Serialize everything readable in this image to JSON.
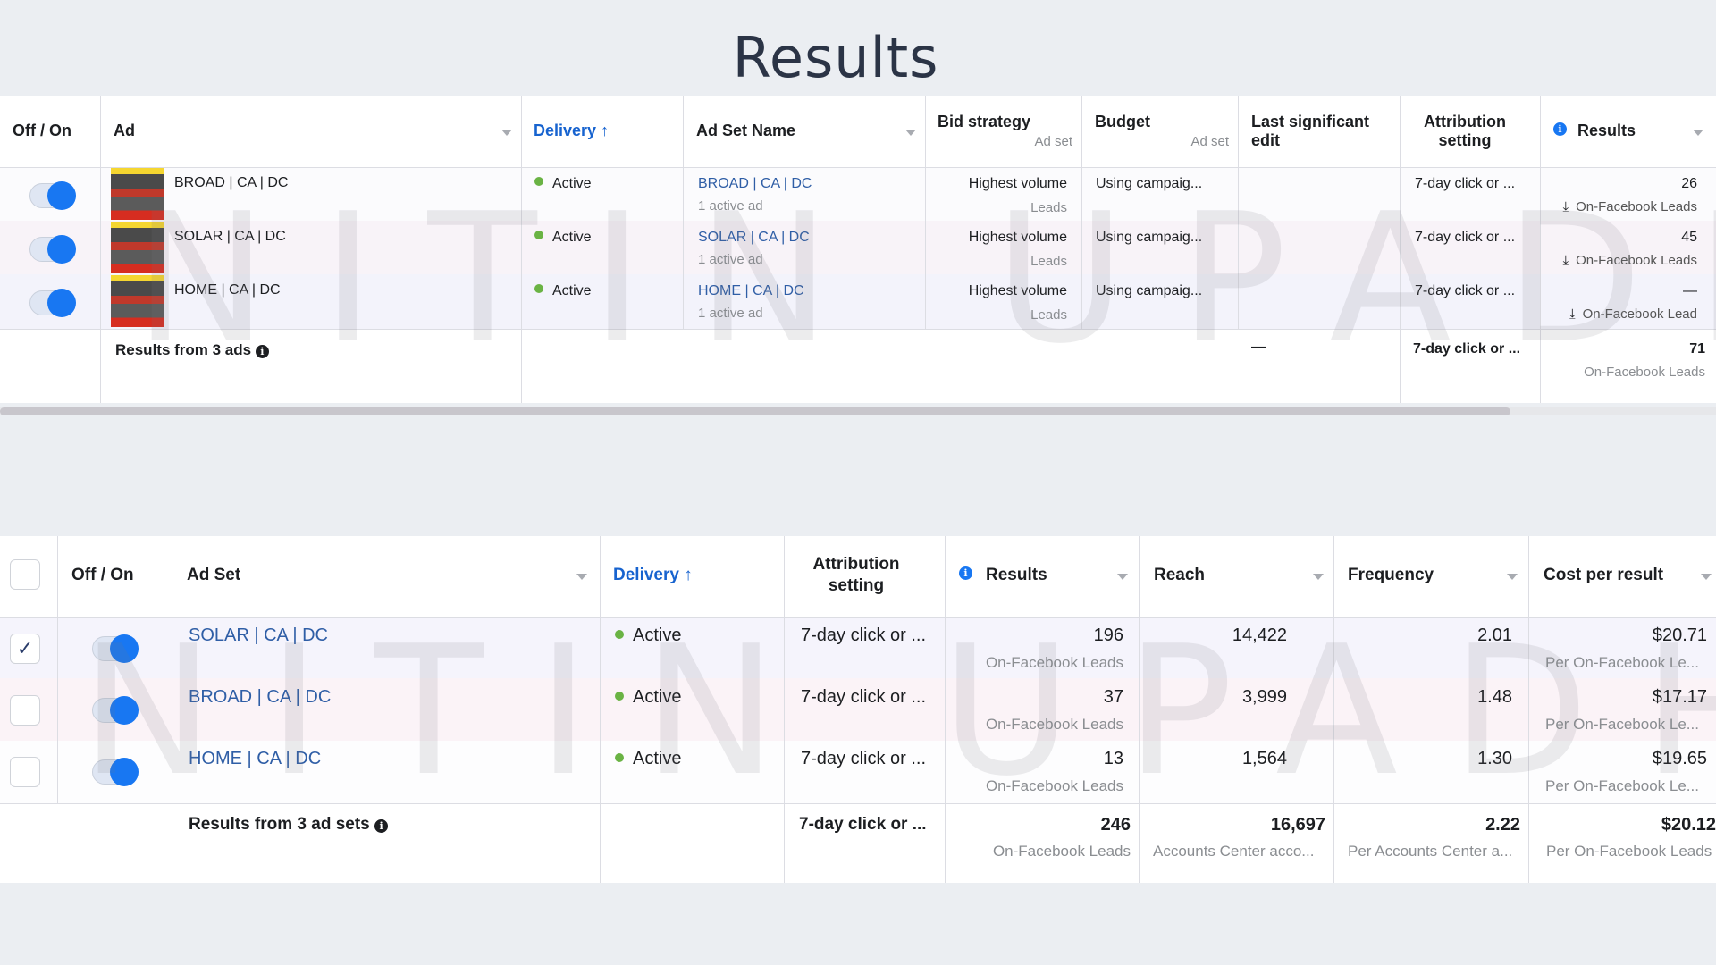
{
  "page": {
    "title": "Results",
    "watermark": "NITIN UPADHYAY"
  },
  "ads_table": {
    "columns": [
      {
        "label": "Off / On"
      },
      {
        "label": "Ad"
      },
      {
        "label": "Delivery",
        "sorted": "ascending",
        "sort_icon": "arrow-up-icon"
      },
      {
        "label": "Ad Set Name"
      },
      {
        "label": "Bid strategy",
        "sublabel": "Ad set"
      },
      {
        "label": "Budget",
        "sublabel": "Ad set"
      },
      {
        "label": "Last significant edit"
      },
      {
        "label": "Attribution setting"
      },
      {
        "label": "Results"
      }
    ],
    "rows": [
      {
        "toggle_on": true,
        "ad": "BROAD | CA | DC",
        "delivery": "Active",
        "ad_set_name": "BROAD | CA | DC",
        "ad_set_sub": "1 active ad",
        "bid_strategy": "Highest volume",
        "bid_sub": "Leads",
        "budget": "Using campaig...",
        "last_edit": "",
        "attribution": "7-day click or ...",
        "results": "26",
        "results_sub": "On-Facebook Leads"
      },
      {
        "toggle_on": true,
        "ad": "SOLAR | CA | DC",
        "delivery": "Active",
        "ad_set_name": "SOLAR | CA | DC",
        "ad_set_sub": "1 active ad",
        "bid_strategy": "Highest volume",
        "bid_sub": "Leads",
        "budget": "Using campaig...",
        "last_edit": "",
        "attribution": "7-day click or ...",
        "results": "45",
        "results_sub": "On-Facebook Leads"
      },
      {
        "toggle_on": true,
        "ad": "HOME | CA | DC",
        "delivery": "Active",
        "ad_set_name": "HOME | CA | DC",
        "ad_set_sub": "1 active ad",
        "bid_strategy": "Highest volume",
        "bid_sub": "Leads",
        "budget": "Using campaig...",
        "last_edit": "",
        "attribution": "7-day click or ...",
        "results": "—",
        "results_sub": "On-Facebook Lead"
      }
    ],
    "summary": {
      "label": "Results from 3 ads",
      "last_edit": "—",
      "attribution": "7-day click or ...",
      "results": "71",
      "results_sub": "On-Facebook Leads"
    }
  },
  "adsets_table": {
    "columns": [
      {
        "label": ""
      },
      {
        "label": "Off / On"
      },
      {
        "label": "Ad Set"
      },
      {
        "label": "Delivery",
        "sorted": "ascending",
        "sort_icon": "arrow-up-icon"
      },
      {
        "label": "Attribution setting"
      },
      {
        "label": "Results"
      },
      {
        "label": "Reach"
      },
      {
        "label": "Frequency"
      },
      {
        "label": "Cost per result"
      }
    ],
    "rows": [
      {
        "selected": true,
        "toggle_on": true,
        "ad_set": "SOLAR | CA | DC",
        "delivery": "Active",
        "attribution": "7-day click or ...",
        "results": "196",
        "results_sub": "On-Facebook Leads",
        "reach": "14,422",
        "frequency": "2.01",
        "cost": "$20.71",
        "cost_sub": "Per On-Facebook Le..."
      },
      {
        "selected": false,
        "toggle_on": true,
        "ad_set": "BROAD | CA | DC",
        "delivery": "Active",
        "attribution": "7-day click or ...",
        "results": "37",
        "results_sub": "On-Facebook Leads",
        "reach": "3,999",
        "frequency": "1.48",
        "cost": "$17.17",
        "cost_sub": "Per On-Facebook Le..."
      },
      {
        "selected": false,
        "toggle_on": true,
        "ad_set": "HOME | CA | DC",
        "delivery": "Active",
        "attribution": "7-day click or ...",
        "results": "13",
        "results_sub": "On-Facebook Leads",
        "reach": "1,564",
        "frequency": "1.30",
        "cost": "$19.65",
        "cost_sub": "Per On-Facebook Le..."
      }
    ],
    "summary": {
      "label": "Results from 3 ad sets",
      "attribution": "7-day click or ...",
      "results": "246",
      "results_sub": "On-Facebook Leads",
      "reach": "16,697",
      "reach_sub": "Accounts Center acco...",
      "frequency": "2.22",
      "frequency_sub": "Per Accounts Center a...",
      "cost": "$20.12",
      "cost_sub": "Per On-Facebook Leads"
    }
  },
  "colors": {
    "accent": "#1877f2",
    "active_dot": "#6ab344",
    "link": "#2f5ea6",
    "sort_header": "#1763cf",
    "background": "#ebeef2"
  },
  "icons": {
    "sort": "↑",
    "info": "i",
    "check": "✓",
    "download": "⤓"
  }
}
